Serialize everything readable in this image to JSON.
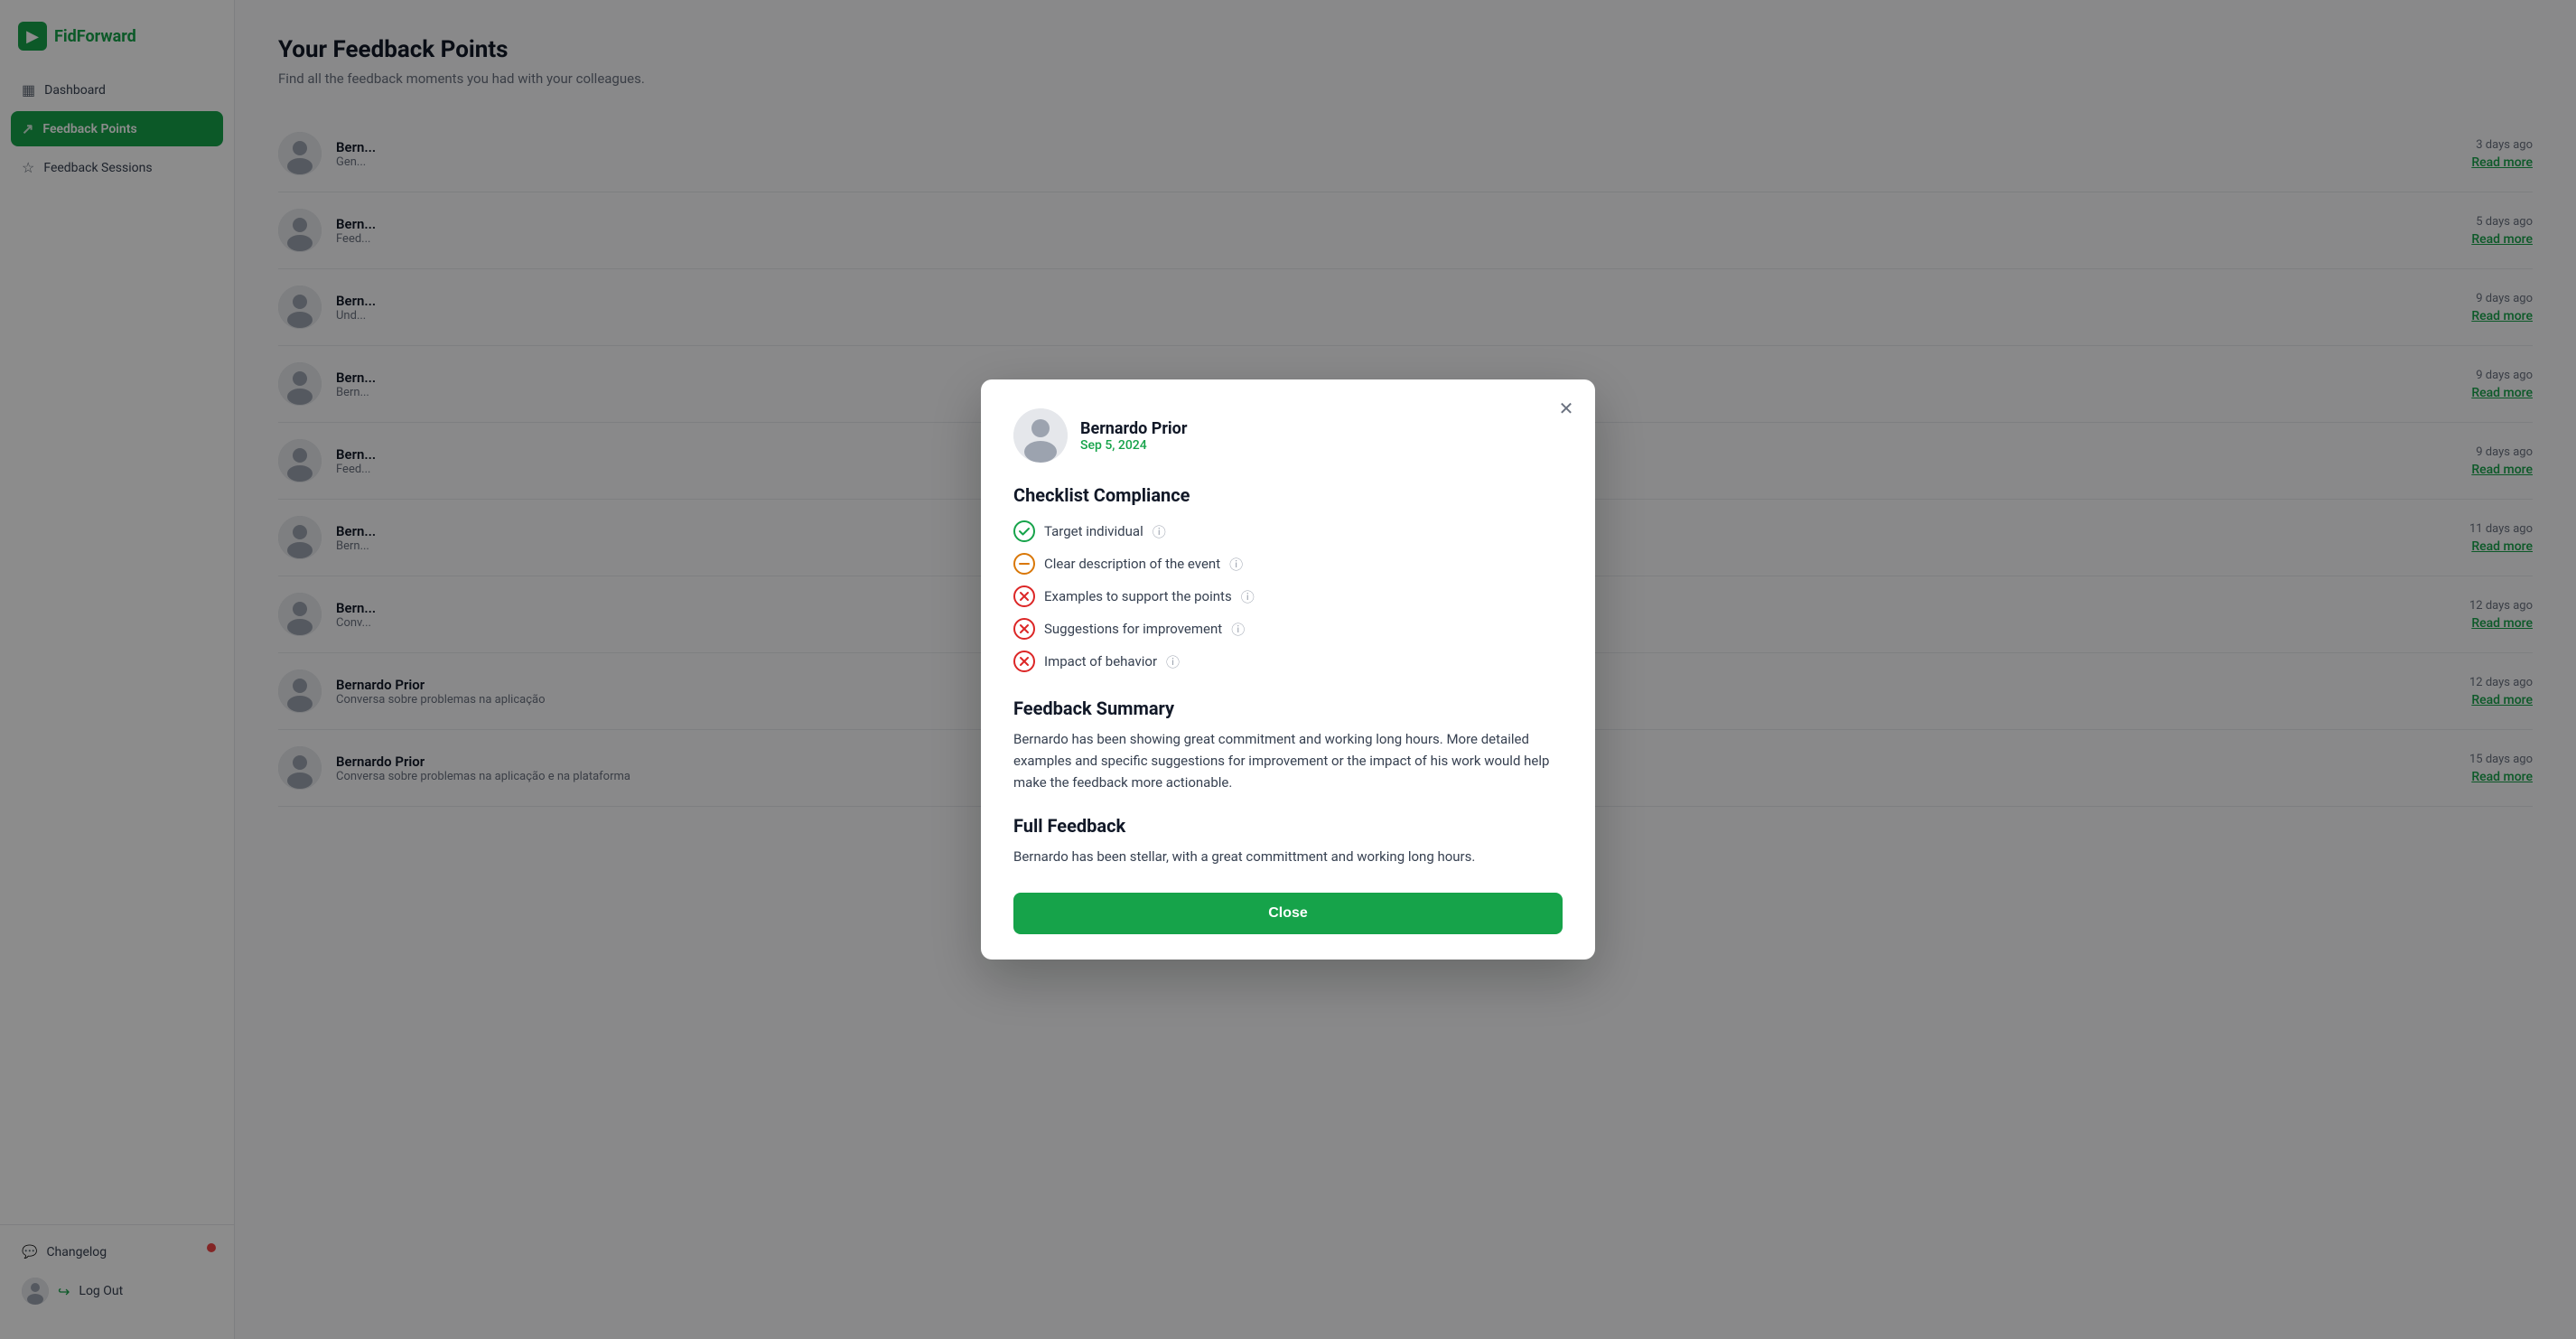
{
  "app": {
    "logo_text_regular": "Fid",
    "logo_text_brand": "Forward"
  },
  "sidebar": {
    "items": [
      {
        "id": "dashboard",
        "label": "Dashboard",
        "icon": "▦",
        "active": false
      },
      {
        "id": "feedback-points",
        "label": "Feedback Points",
        "icon": "↗",
        "active": true
      },
      {
        "id": "feedback-sessions",
        "label": "Feedback Sessions",
        "icon": "☆",
        "active": false
      }
    ],
    "changelog": {
      "label": "Changelog",
      "has_dot": true
    },
    "logout": {
      "label": "Log Out"
    }
  },
  "main": {
    "title": "Your Feedback Points",
    "subtitle": "Find all the feedback moments you had with your colleagues."
  },
  "feedback_items": [
    {
      "id": 1,
      "name": "Bern...",
      "desc": "Gen...",
      "time": "3 days ago",
      "read_more": "Read more"
    },
    {
      "id": 2,
      "name": "Bern...",
      "desc": "Feed...",
      "time": "5 days ago",
      "read_more": "Read more"
    },
    {
      "id": 3,
      "name": "Bern...",
      "desc": "Und...",
      "time": "9 days ago",
      "read_more": "Read more"
    },
    {
      "id": 4,
      "name": "Bern...",
      "desc": "Bern...",
      "time": "9 days ago",
      "read_more": "Read more"
    },
    {
      "id": 5,
      "name": "Bern...",
      "desc": "Feed...",
      "time": "9 days ago",
      "read_more": "Read more"
    },
    {
      "id": 6,
      "name": "Bern...",
      "desc": "Bern...",
      "time": "11 days ago",
      "read_more": "Read more"
    },
    {
      "id": 7,
      "name": "Bern...",
      "desc": "Conv...",
      "time": "12 days ago",
      "read_more": "Read more"
    },
    {
      "id": 8,
      "name": "Bernardo Prior",
      "desc": "Conversa sobre problemas na aplicação",
      "time": "12 days ago",
      "read_more": "Read more"
    },
    {
      "id": 9,
      "name": "Bernardo Prior",
      "desc": "Conversa sobre problemas na aplicação e na plataforma",
      "time": "15 days ago",
      "read_more": "Read more"
    }
  ],
  "modal": {
    "user_name": "Bernardo Prior",
    "user_date": "Sep 5, 2024",
    "checklist_title": "Checklist Compliance",
    "checklist_items": [
      {
        "label": "Target individual",
        "status": "pass",
        "has_info": true
      },
      {
        "label": "Clear description of the event",
        "status": "warn",
        "has_info": true
      },
      {
        "label": "Examples to support the points",
        "status": "fail",
        "has_info": true
      },
      {
        "label": "Suggestions for improvement",
        "status": "fail",
        "has_info": true
      },
      {
        "label": "Impact of behavior",
        "status": "fail",
        "has_info": true
      }
    ],
    "feedback_summary_title": "Feedback Summary",
    "feedback_summary_text": "Bernardo has been showing great commitment and working long hours. More detailed examples and specific suggestions for improvement or the impact of his work would help make the feedback more actionable.",
    "full_feedback_title": "Full Feedback",
    "full_feedback_text": "Bernardo has been stellar, with a great committment and working long hours.",
    "close_label": "Close",
    "close_icon": "✕"
  }
}
